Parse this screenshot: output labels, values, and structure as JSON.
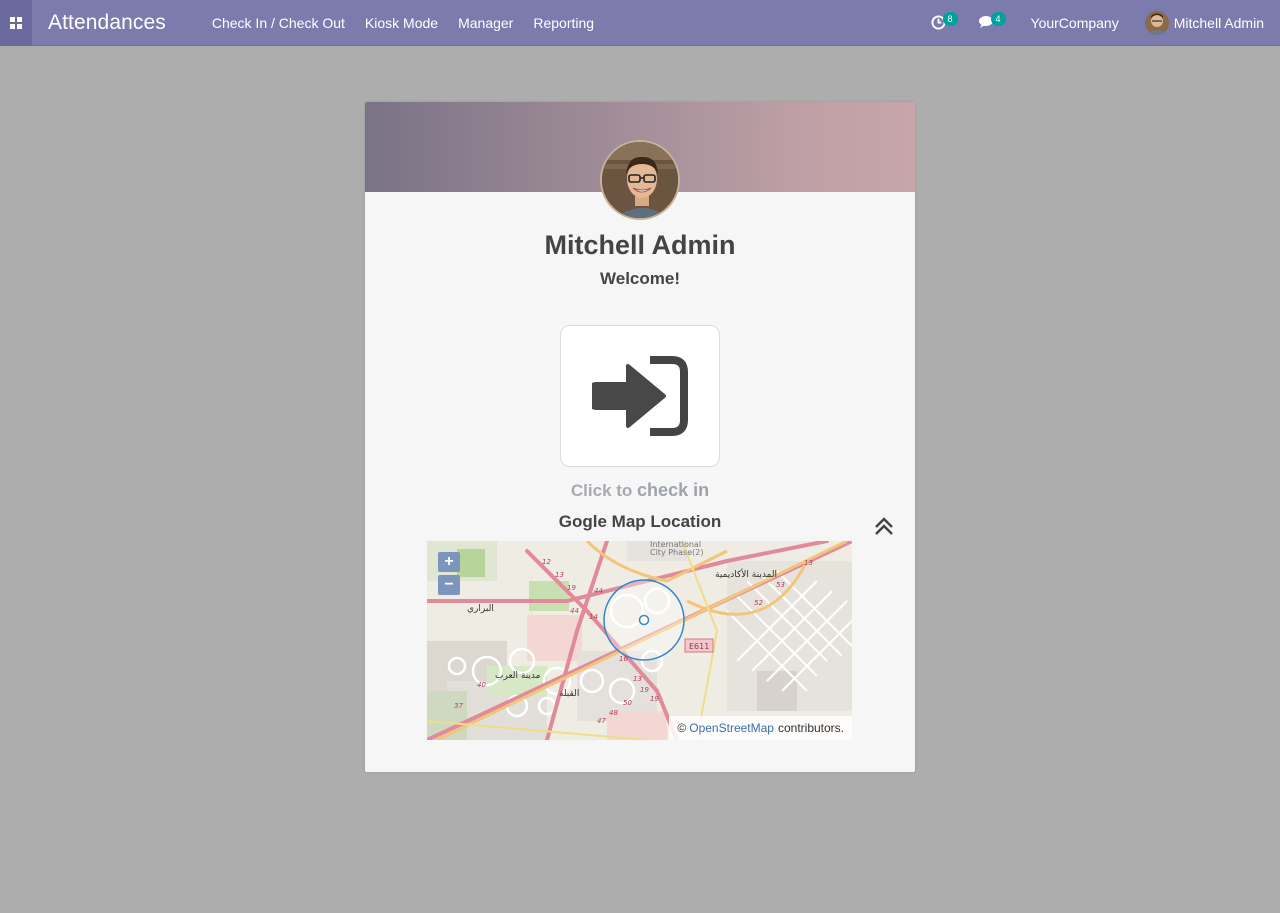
{
  "navbar": {
    "app_title": "Attendances",
    "menu": [
      "Check In / Check Out",
      "Kiosk Mode",
      "Manager",
      "Reporting"
    ],
    "activity_icon": "clock-icon",
    "activity_count": "8",
    "messages_icon": "comments-icon",
    "messages_count": "4",
    "company": "YourCompany",
    "user_name": "Mitchell Admin"
  },
  "card": {
    "employee_name": "Mitchell Admin",
    "greeting": "Welcome!",
    "checkin_icon": "sign-in-icon",
    "click_prefix": "Click to",
    "click_action": "check in",
    "map_title": "Gogle Map Location",
    "collapse_icon": "double-chevron-up-icon"
  },
  "map": {
    "zoom_in": "+",
    "zoom_out": "−",
    "attribution_prefix": "©",
    "attribution_link": "OpenStreetMap",
    "attribution_suffix": "contributors.",
    "labels": [
      "International",
      "City Phase(2)",
      "المدينة الأكاديمية",
      "البراري",
      "مدينة العرب",
      "القبلة",
      "E611"
    ],
    "road_numbers": [
      "12",
      "13",
      "19",
      "44",
      "14",
      "44",
      "16",
      "13",
      "19",
      "19",
      "50",
      "48",
      "47",
      "53",
      "52",
      "13",
      "40",
      "37"
    ]
  },
  "colors": {
    "navbar": "#7c7bad",
    "badge": "#00a09d",
    "background": "#adadad",
    "link": "#3a6fa8"
  }
}
